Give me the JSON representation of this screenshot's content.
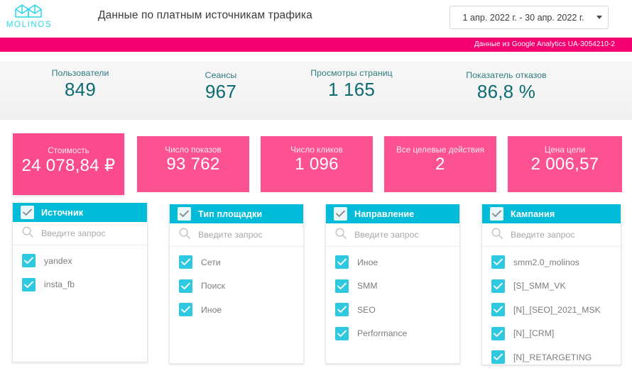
{
  "header": {
    "logo_word": "MOLINOS",
    "logo_icon": "molinos-logo-icon",
    "title": "Данные по платным источникам трафика",
    "daterange": {
      "value": "1 апр. 2022 г. - 30 апр. 2022 г.",
      "caret_icon": "chevron-down-icon"
    }
  },
  "banner": {
    "text": "Данные из Google Analytics UA-3054210-2",
    "color": "#f50071"
  },
  "kpis": [
    {
      "label": "Пользователи",
      "value": "849"
    },
    {
      "label": "Сеансы",
      "value": "967"
    },
    {
      "label": "Просмотры страниц",
      "value": "1 165"
    },
    {
      "label": "Показатель отказов",
      "value": "86,8 %"
    }
  ],
  "kpi_color": "#0e6b73",
  "cards": [
    {
      "label": "Стоимость",
      "value": "24 078,84 ₽"
    },
    {
      "label": "Число показов",
      "value": "93 762"
    },
    {
      "label": "Число кликов",
      "value": "1 096"
    },
    {
      "label": "Все целевые действия",
      "value": "2"
    },
    {
      "label": "Цена цели",
      "value": "2 006,57"
    }
  ],
  "card_color": "#fc5291",
  "accent_color": "#00bcd8",
  "search_placeholder": "Введите запрос",
  "search_icon": "search-icon",
  "check_icon": "check-icon",
  "panels": [
    {
      "title": "Источник",
      "items": [
        "yandex",
        "insta_fb"
      ]
    },
    {
      "title": "Тип площадки",
      "items": [
        "Сети",
        "Поиск",
        "Иное"
      ]
    },
    {
      "title": "Направление",
      "items": [
        "Иное",
        "SMM",
        "SEO",
        "Performance"
      ]
    },
    {
      "title": "Кампания",
      "items": [
        "smm2.0_molinos",
        "[S]_SMM_VK",
        "[N]_[SEO]_2021_MSK",
        "[N]_[CRM]",
        "[N]_RETARGETING"
      ]
    }
  ]
}
